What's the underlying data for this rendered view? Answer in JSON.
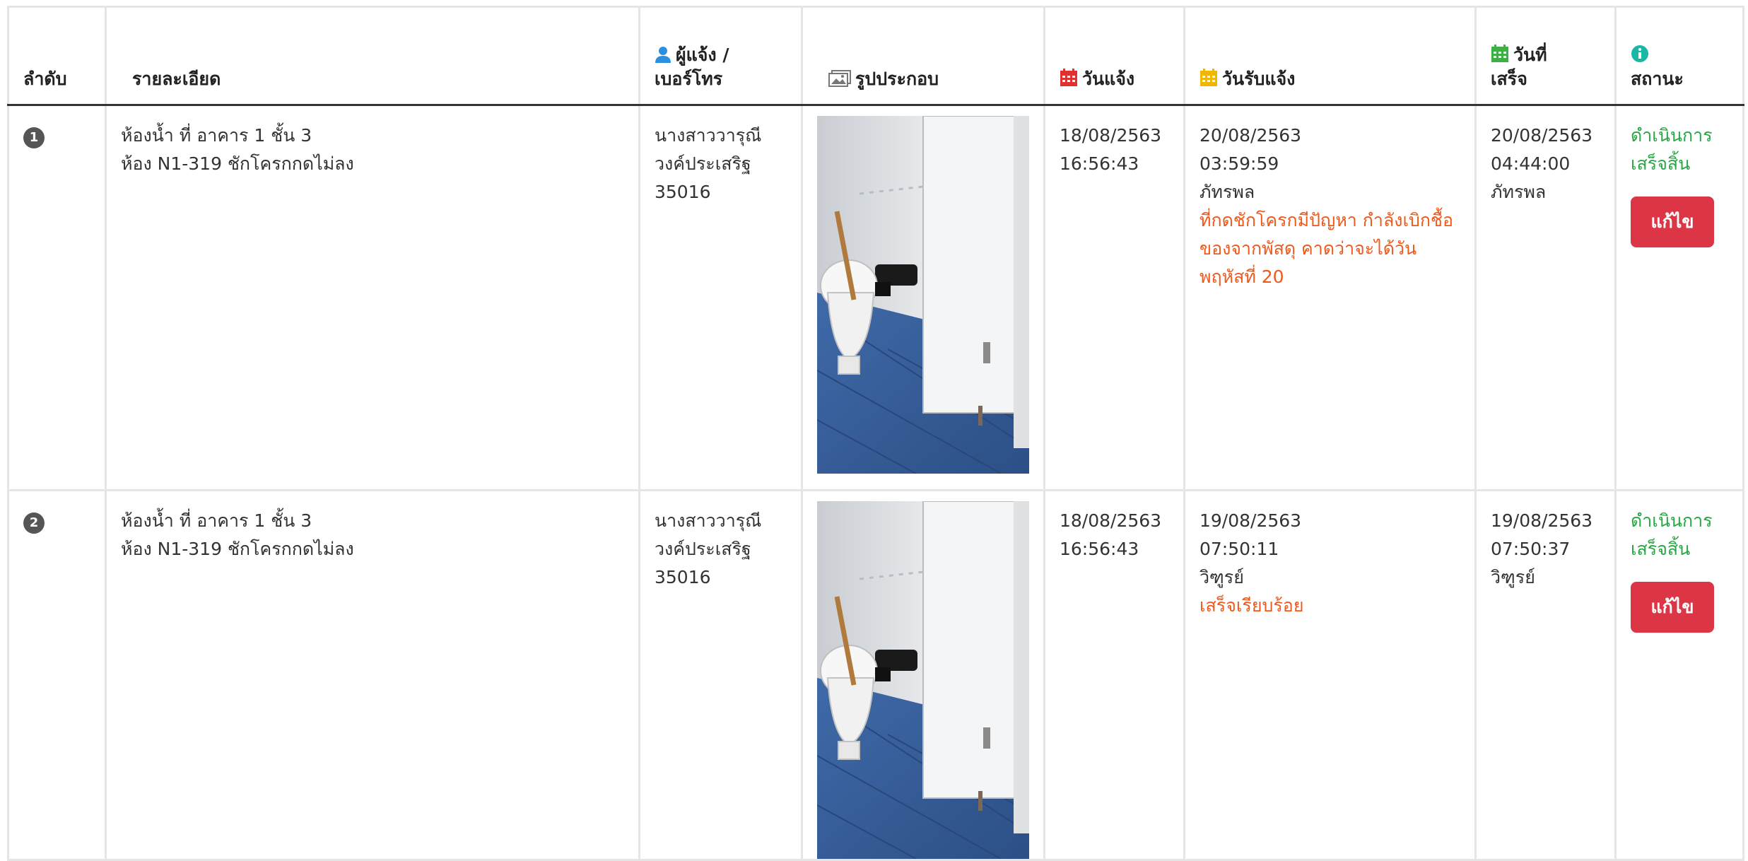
{
  "table": {
    "headers": {
      "seq": "ลำดับ",
      "detail": "รายละเอียด",
      "reporter_line1": "ผู้แจ้ง /",
      "reporter_line2": "เบอร์โทร",
      "photo": "รูปประกอบ",
      "report_date": "วันแจ้ง",
      "received_date": "วันรับแจ้ง",
      "done_line1": "วันที่",
      "done_line2": "เสร็จ",
      "status": "สถานะ"
    },
    "icons": {
      "reporter": "user-icon",
      "photo": "image-icon",
      "report_date": "calendar-icon",
      "received_date": "calendar-icon",
      "done_date": "calendar-check-icon",
      "status": "info-icon"
    },
    "colors": {
      "reporter_icon": "#2b8fe0",
      "photo_icon": "#777777",
      "report_date_icon": "#e03030",
      "received_date_icon": "#f2b500",
      "done_date_icon": "#3cb043",
      "status_icon": "#17b8a6",
      "note": "#ef5a1c",
      "status_done": "#28a745",
      "edit_button": "#dc3545"
    },
    "rows": [
      {
        "seq": "1",
        "detail_line1": "ห้องน้ำ ที่ อาคาร 1 ชั้น 3",
        "detail_line2": "ห้อง N1-319 ชักโครกกดไม่ลง",
        "reporter_name1": "นางสาววารุณี",
        "reporter_name2": "วงค์ประเสริฐ",
        "reporter_phone": "35016",
        "report_date": "18/08/2563",
        "report_time": "16:56:43",
        "received_date": "20/08/2563",
        "received_time": "03:59:59",
        "received_by": "ภัทรพล",
        "received_note": "ที่กดชักโครกมีปัญหา กำลังเบิกชื้อของจากพัสดุ คาดว่าจะได้วันพฤหัสที่ 20",
        "done_date": "20/08/2563",
        "done_time": "04:44:00",
        "done_by": "ภัทรพล",
        "status_line1": "ดำเนินการ",
        "status_line2": "เสร็จสิ้น",
        "edit_label": "แก้ไข"
      },
      {
        "seq": "2",
        "detail_line1": "ห้องน้ำ ที่ อาคาร 1 ชั้น 3",
        "detail_line2": "ห้อง N1-319 ชักโครกกดไม่ลง",
        "reporter_name1": "นางสาววารุณี",
        "reporter_name2": "วงค์ประเสริฐ",
        "reporter_phone": "35016",
        "report_date": "18/08/2563",
        "report_time": "16:56:43",
        "received_date": "19/08/2563",
        "received_time": "07:50:11",
        "received_by": "วิฑูรย์",
        "received_note": "เสร็จเรียบร้อย",
        "done_date": "19/08/2563",
        "done_time": "07:50:37",
        "done_by": "วิฑูรย์",
        "status_line1": "ดำเนินการ",
        "status_line2": "เสร็จสิ้น",
        "edit_label": "แก้ไข"
      }
    ]
  }
}
